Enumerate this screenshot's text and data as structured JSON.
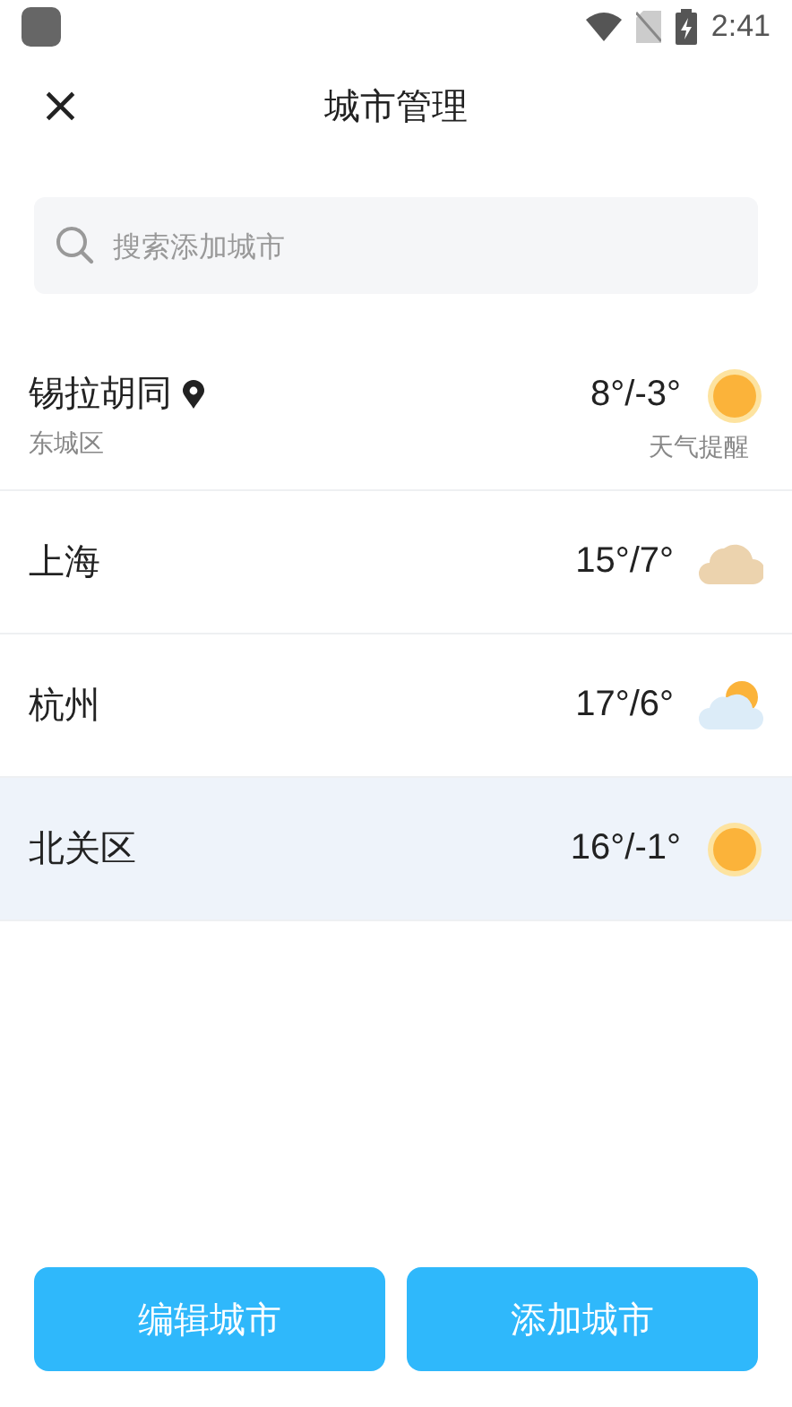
{
  "status_bar": {
    "time": "2:41"
  },
  "header": {
    "close_icon": "×",
    "title": "城市管理"
  },
  "search": {
    "placeholder": "搜索添加城市"
  },
  "cities": [
    {
      "name": "锡拉胡同",
      "located": true,
      "district": "东城区",
      "temps": "8°/-3°",
      "weather_icon": {
        "kind": "sunny"
      },
      "note": "天气提醒",
      "selected": false
    },
    {
      "name": "上海",
      "located": false,
      "temps": "15°/7°",
      "weather_icon": {
        "kind": "cloudy"
      },
      "selected": false
    },
    {
      "name": "杭州",
      "located": false,
      "temps": "17°/6°",
      "weather_icon": {
        "kind": "partly_cloudy"
      },
      "selected": false
    },
    {
      "name": "北关区",
      "located": false,
      "temps": "16°/-1°",
      "weather_icon": {
        "kind": "sunny"
      },
      "selected": true
    }
  ],
  "buttons": [
    {
      "label": "编辑城市"
    },
    {
      "label": "添加城市"
    }
  ]
}
